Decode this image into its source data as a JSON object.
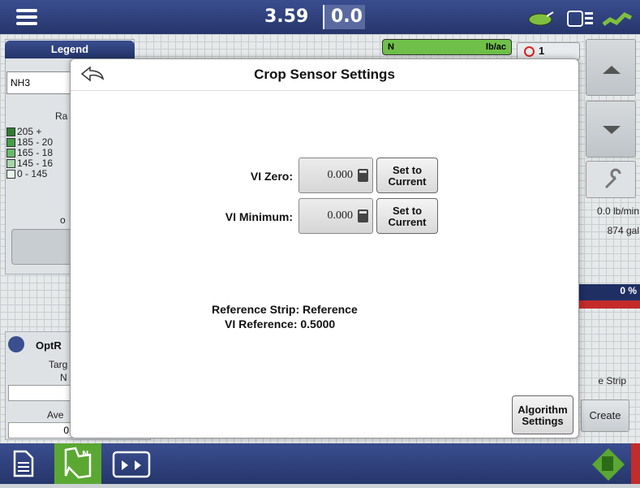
{
  "topbar": {
    "readout_primary": "3.59",
    "readout_secondary": "0.0"
  },
  "legend": {
    "tab_label": "Legend",
    "product": "NH3",
    "rate_header": "Ra",
    "ranges": [
      "205 +",
      "185 - 20",
      "165 - 18",
      "145 - 16",
      "0 - 145"
    ],
    "range_colors": [
      "#2e7d32",
      "#43a047",
      "#66bb6a",
      "#a5d6a7",
      "#e8f5e9"
    ],
    "small_label": "o"
  },
  "right_panel": {
    "n_label": "N",
    "n_unit": "lb/ac",
    "counter": "1",
    "flow_rate": "0.0 lb/min",
    "volume": "874 gal",
    "percent": "0 %",
    "strip_label": "e Strip",
    "create_label": "Create"
  },
  "optrx": {
    "title": "OptR",
    "targ_label": "Targ",
    "n_label": "N",
    "ave_label": "Ave",
    "ave_value": "0"
  },
  "dialog": {
    "title": "Crop Sensor Settings",
    "vi_zero_label": "VI Zero:",
    "vi_zero_value": "0.000",
    "vi_min_label": "VI Minimum:",
    "vi_min_value": "0.000",
    "set_current_label_1": "Set to",
    "set_current_label_2": "Current",
    "reference_strip": "Reference Strip: Reference",
    "vi_reference": "VI Reference: 0.5000",
    "algo_label_1": "Algorithm",
    "algo_label_2": "Settings"
  },
  "colors": {
    "bar_blue": "#2c3d7a",
    "n_green": "#6fbf4a",
    "accent_red": "#c42b2b"
  }
}
